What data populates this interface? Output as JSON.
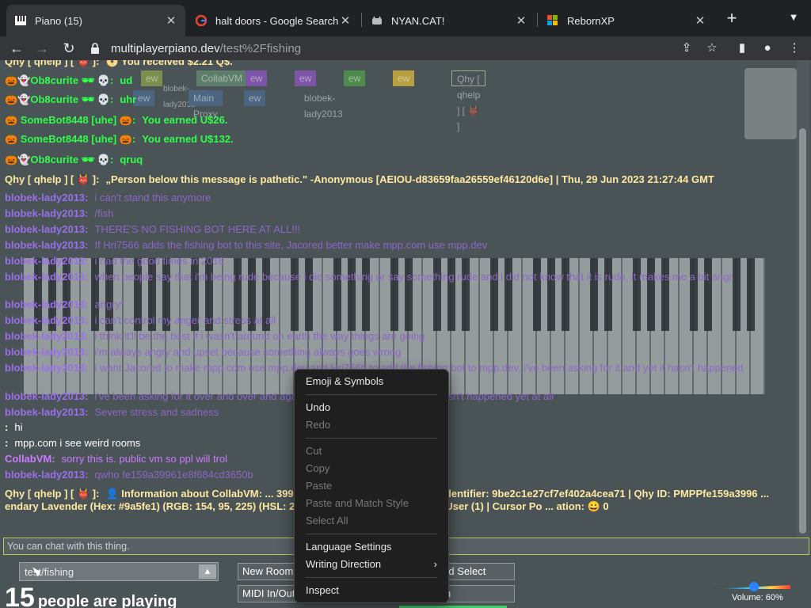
{
  "tabs": [
    {
      "title": "Piano (15)",
      "favicon": "piano-icon",
      "active": true
    },
    {
      "title": "halt doors - Google Search",
      "favicon": "google-icon"
    },
    {
      "title": "NYAN.CAT!",
      "favicon": "cat-icon"
    },
    {
      "title": "RebornXP",
      "favicon": "windows-icon"
    }
  ],
  "toolbar": {
    "url_host": "multiplayerpiano.dev",
    "url_path": "/test%2Ffishing"
  },
  "cursors": [
    "ew",
    "CollabVM",
    "ew",
    "ew",
    "ew",
    "ew",
    "Qhy [ qhelp ] [ 👹 ]",
    "blobek-lady2013",
    "ew",
    "Main Proxy",
    "ew",
    "blobek-lady2013"
  ],
  "chat": [
    {
      "nick": "Qhy [ qhelp ] [ 👹 ]:",
      "nick_color": "#ffe9a0",
      "text": "📀 You received $2.21 Q$.",
      "text_color": "#ffe9a0"
    },
    {
      "nick": "🎃👻Ob8curite 🕶 💀:",
      "nick_color": "#2fff4a",
      "text": "ud",
      "text_color": "#2fff4a"
    },
    {
      "nick": "🎃👻Ob8curite 🕶 💀:",
      "nick_color": "#2fff4a",
      "text": "uhr",
      "text_color": "#2fff4a"
    },
    {
      "nick": "🎃 SomeBot8448 [uhe] 🎃:",
      "nick_color": "#2fff4a",
      "text": "You earned U$26.",
      "text_color": "#2fff4a"
    },
    {
      "nick": "🎃 SomeBot8448 [uhe] 🎃:",
      "nick_color": "#2fff4a",
      "text": "You earned U$132.",
      "text_color": "#2fff4a"
    },
    {
      "nick": "🎃👻Ob8curite 🕶 💀:",
      "nick_color": "#2fff4a",
      "text": "qruq",
      "text_color": "#2fff4a"
    },
    {
      "nick": "Qhy [ qhelp ] [ 👹 ]:",
      "nick_color": "#ffe9a0",
      "text": "„Person below this message is pathetic.\" -Anonymous [AEIOU-d83659faa26559ef46120d6e] | Thu, 29 Jun 2023 21:27:44 GMT",
      "text_color": "#ffe9a0"
    },
    {
      "nick": "blobek-lady2013:",
      "nick_color": "#9a5fe1",
      "text": "i can't stand this anymore",
      "text_color": "#9a5fe1"
    },
    {
      "nick": "blobek-lady2013:",
      "nick_color": "#9a5fe1",
      "text": "/fish",
      "text_color": "#9a5fe1"
    },
    {
      "nick": "blobek-lady2013:",
      "nick_color": "#9a5fe1",
      "text": "THERE'S NO FISHING BOT HERE AT ALL!!!",
      "text_color": "#9a5fe1"
    },
    {
      "nick": "blobek-lady2013:",
      "nick_color": "#9a5fe1",
      "text": "If Hri7566 adds the fishing bot to this site, Jacored better make mpp.com use mpp.dev",
      "text_color": "#9a5fe1"
    },
    {
      "nick": "blobek-lady2013:",
      "nick_color": "#9a5fe1",
      "text": "i had the good times in 2016",
      "text_color": "#9a5fe1"
    },
    {
      "nick": "blobek-lady2013:",
      "nick_color": "#9a5fe1",
      "text": "when people say that i'm being rude because i did something or say something rude and i did not know that it is rude, it makes me a bit angr",
      "text_color": "#9a5fe1"
    },
    {
      "nick": "blobek-lady2013:",
      "nick_color": "#9a5fe1",
      "text": "angry*",
      "text_color": "#9a5fe1"
    },
    {
      "nick": "blobek-lady2013:",
      "nick_color": "#9a5fe1",
      "text": "i can't control my anger and stress at all",
      "text_color": "#9a5fe1"
    },
    {
      "nick": "blobek-lady2013:",
      "nick_color": "#9a5fe1",
      "text": "i think it'll be the best if i wasn't around on earth the way things are going",
      "text_color": "#9a5fe1"
    },
    {
      "nick": "blobek-lady2013:",
      "nick_color": "#9a5fe1",
      "text": "i'm always angry and upset because something always goes wrong",
      "text_color": "#9a5fe1"
    },
    {
      "nick": "blobek-lady2013:",
      "nick_color": "#9a5fe1",
      "text": "i want Jacored to make mpp.com use mpp.dev and Hri7566 to add the fishing bot to mpp.dev, i've been asking for it and yet it hasn't happened",
      "text_color": "#9a5fe1"
    },
    {
      "nick": "blobek-lady2013:",
      "nick_color": "#9a5fe1",
      "text": "i've been asking for it over and over and again and again day by day and it hasn't happened yet at all",
      "text_color": "#9a5fe1"
    },
    {
      "nick": "blobek-lady2013:",
      "nick_color": "#9a5fe1",
      "text": "Severe stress and sadness",
      "text_color": "#9a5fe1"
    },
    {
      "nick": ":",
      "nick_color": "#ffffff",
      "text": "hi",
      "text_color": "#ffffff"
    },
    {
      "nick": ":",
      "nick_color": "#ffffff",
      "text": "mpp.com i see weird rooms",
      "text_color": "#ffffff"
    },
    {
      "nick": "CollabVM:",
      "nick_color": "#c97cff",
      "text": "sorry this is. public vm so ppl will trol",
      "text_color": "#c97cff"
    },
    {
      "nick": "blobek-lady2013:",
      "nick_color": "#9a5fe1",
      "text": "qwho fe159a39961e8f684cd3650b",
      "text_color": "#9a5fe1"
    },
    {
      "nick": "Qhy [ qhelp ] [ 👹 ]:",
      "nick_color": "#ffe9a0",
      "text": "👤 Information about CollabVM: ... 39961e8f684cd3650b | Temporary Identifier: 9be2c1e27cf7ef402a4cea71 | Qhy ID: PMPPfe159a3996 ... endary Lavender (Hex: #9a5fe1) (RGB: 154, 95, 225) (HSL: 267.23, 68.42%, 62.75%) | Rank: User (1) | Cursor Po ... ation: 😀 0",
      "text_color": "#ffe9a0"
    }
  ],
  "chat_input": {
    "placeholder": "You can chat with this thing."
  },
  "bottom": {
    "room": "test/fishing",
    "new_room": "New Room",
    "midi": "MIDI In/Out",
    "sound_select": "Sound Select",
    "synth": "Synth",
    "people_count": "15",
    "people_label": "people are playing",
    "volume_label": "Volume: 60%",
    "volume_value": 0.6
  },
  "context_menu": [
    {
      "label": "Emoji & Symbols",
      "enabled": true
    },
    "sep",
    {
      "label": "Undo",
      "enabled": true
    },
    {
      "label": "Redo",
      "enabled": false
    },
    "sep",
    {
      "label": "Cut",
      "enabled": false
    },
    {
      "label": "Copy",
      "enabled": false
    },
    {
      "label": "Paste",
      "enabled": false
    },
    {
      "label": "Paste and Match Style",
      "enabled": false
    },
    {
      "label": "Select All",
      "enabled": false
    },
    "sep",
    {
      "label": "Language Settings",
      "enabled": true
    },
    {
      "label": "Writing Direction",
      "enabled": true,
      "submenu": true
    },
    "sep",
    {
      "label": "Inspect",
      "enabled": true
    }
  ]
}
